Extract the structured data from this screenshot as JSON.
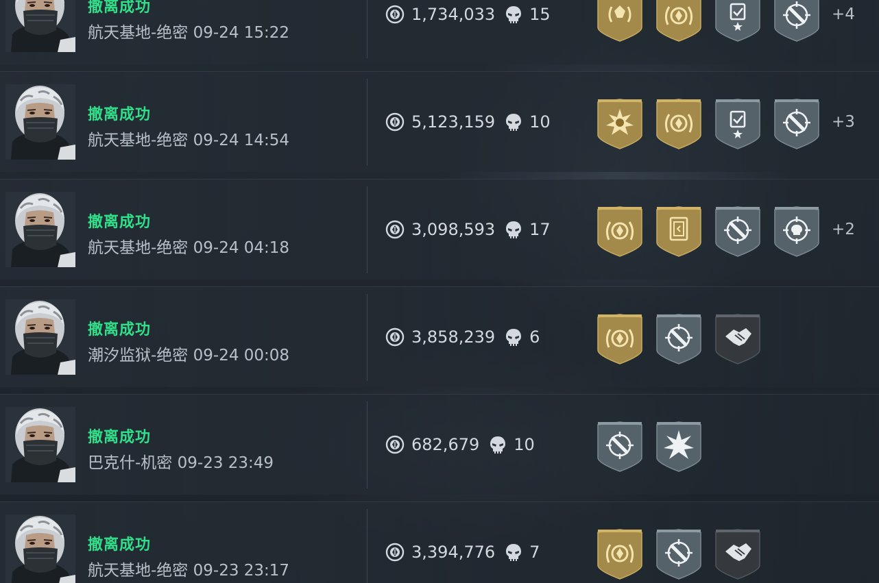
{
  "colors": {
    "success": "#2fe08a",
    "gold_badge": "#a48a4a",
    "silver_badge": "#5b676f",
    "dark_badge": "#3a3e42",
    "text": "#d3d9df"
  },
  "records": [
    {
      "status": "撤离成功",
      "map": "航天基地-绝密",
      "time": "09-24 15:22",
      "value": "1,734,033",
      "kills": "15",
      "badges": [
        {
          "tier": "gold",
          "icon": "laurel-crest-icon"
        },
        {
          "tier": "gold",
          "icon": "coin-laurel-icon"
        },
        {
          "tier": "silver",
          "icon": "card-star-icon"
        },
        {
          "tier": "silver",
          "icon": "crosshair-bullet-icon"
        }
      ],
      "extra": "+4"
    },
    {
      "status": "撤离成功",
      "map": "航天基地-绝密",
      "time": "09-24 14:54",
      "value": "5,123,159",
      "kills": "10",
      "badges": [
        {
          "tier": "gold",
          "icon": "burst-skull-icon"
        },
        {
          "tier": "gold",
          "icon": "coin-laurel-icon"
        },
        {
          "tier": "silver",
          "icon": "card-star-icon"
        },
        {
          "tier": "silver",
          "icon": "crosshair-bullet-icon"
        }
      ],
      "extra": "+3"
    },
    {
      "status": "撤离成功",
      "map": "航天基地-绝密",
      "time": "09-24 04:18",
      "value": "3,098,593",
      "kills": "17",
      "badges": [
        {
          "tier": "gold",
          "icon": "coin-laurel-icon"
        },
        {
          "tier": "gold",
          "icon": "card-frame-icon"
        },
        {
          "tier": "silver",
          "icon": "crosshair-bullet-icon"
        },
        {
          "tier": "silver",
          "icon": "crosshair-skull-icon"
        }
      ],
      "extra": "+2"
    },
    {
      "status": "撤离成功",
      "map": "潮汐监狱-绝密",
      "time": "09-24 00:08",
      "value": "3,858,239",
      "kills": "6",
      "badges": [
        {
          "tier": "gold",
          "icon": "coin-laurel-icon"
        },
        {
          "tier": "silver",
          "icon": "crosshair-bullet-icon"
        },
        {
          "tier": "dark",
          "icon": "handshake-icon"
        }
      ],
      "extra": ""
    },
    {
      "status": "撤离成功",
      "map": "巴克什-机密",
      "time": "09-23 23:49",
      "value": "682,679",
      "kills": "10",
      "badges": [
        {
          "tier": "silver",
          "icon": "crosshair-bullet-icon"
        },
        {
          "tier": "silver",
          "icon": "burst-icon"
        }
      ],
      "extra": ""
    },
    {
      "status": "撤离成功",
      "map": "航天基地-绝密",
      "time": "09-23 23:17",
      "value": "3,394,776",
      "kills": "7",
      "badges": [
        {
          "tier": "gold",
          "icon": "coin-laurel-icon"
        },
        {
          "tier": "silver",
          "icon": "crosshair-bullet-icon"
        },
        {
          "tier": "dark",
          "icon": "handshake-icon"
        }
      ],
      "extra": ""
    }
  ]
}
